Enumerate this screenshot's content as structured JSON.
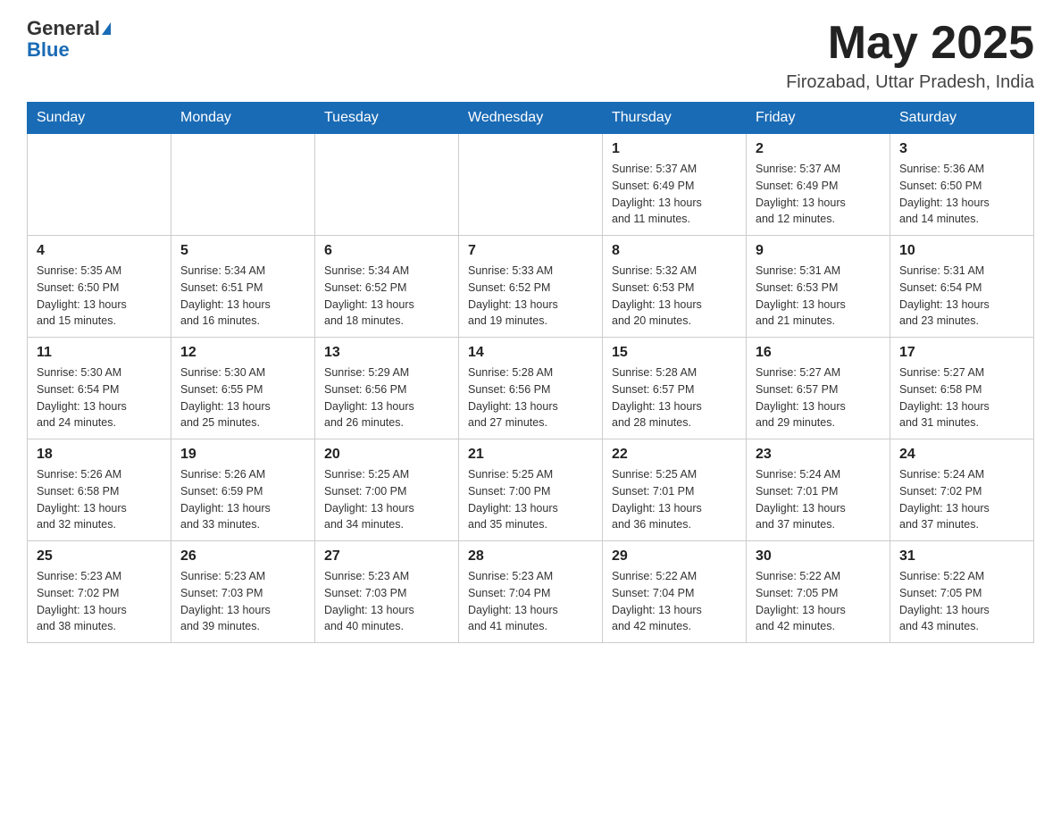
{
  "header": {
    "logo_general": "General",
    "logo_blue": "Blue",
    "month_title": "May 2025",
    "location": "Firozabad, Uttar Pradesh, India"
  },
  "days_of_week": [
    "Sunday",
    "Monday",
    "Tuesday",
    "Wednesday",
    "Thursday",
    "Friday",
    "Saturday"
  ],
  "weeks": [
    [
      {
        "day": "",
        "info": ""
      },
      {
        "day": "",
        "info": ""
      },
      {
        "day": "",
        "info": ""
      },
      {
        "day": "",
        "info": ""
      },
      {
        "day": "1",
        "info": "Sunrise: 5:37 AM\nSunset: 6:49 PM\nDaylight: 13 hours\nand 11 minutes."
      },
      {
        "day": "2",
        "info": "Sunrise: 5:37 AM\nSunset: 6:49 PM\nDaylight: 13 hours\nand 12 minutes."
      },
      {
        "day": "3",
        "info": "Sunrise: 5:36 AM\nSunset: 6:50 PM\nDaylight: 13 hours\nand 14 minutes."
      }
    ],
    [
      {
        "day": "4",
        "info": "Sunrise: 5:35 AM\nSunset: 6:50 PM\nDaylight: 13 hours\nand 15 minutes."
      },
      {
        "day": "5",
        "info": "Sunrise: 5:34 AM\nSunset: 6:51 PM\nDaylight: 13 hours\nand 16 minutes."
      },
      {
        "day": "6",
        "info": "Sunrise: 5:34 AM\nSunset: 6:52 PM\nDaylight: 13 hours\nand 18 minutes."
      },
      {
        "day": "7",
        "info": "Sunrise: 5:33 AM\nSunset: 6:52 PM\nDaylight: 13 hours\nand 19 minutes."
      },
      {
        "day": "8",
        "info": "Sunrise: 5:32 AM\nSunset: 6:53 PM\nDaylight: 13 hours\nand 20 minutes."
      },
      {
        "day": "9",
        "info": "Sunrise: 5:31 AM\nSunset: 6:53 PM\nDaylight: 13 hours\nand 21 minutes."
      },
      {
        "day": "10",
        "info": "Sunrise: 5:31 AM\nSunset: 6:54 PM\nDaylight: 13 hours\nand 23 minutes."
      }
    ],
    [
      {
        "day": "11",
        "info": "Sunrise: 5:30 AM\nSunset: 6:54 PM\nDaylight: 13 hours\nand 24 minutes."
      },
      {
        "day": "12",
        "info": "Sunrise: 5:30 AM\nSunset: 6:55 PM\nDaylight: 13 hours\nand 25 minutes."
      },
      {
        "day": "13",
        "info": "Sunrise: 5:29 AM\nSunset: 6:56 PM\nDaylight: 13 hours\nand 26 minutes."
      },
      {
        "day": "14",
        "info": "Sunrise: 5:28 AM\nSunset: 6:56 PM\nDaylight: 13 hours\nand 27 minutes."
      },
      {
        "day": "15",
        "info": "Sunrise: 5:28 AM\nSunset: 6:57 PM\nDaylight: 13 hours\nand 28 minutes."
      },
      {
        "day": "16",
        "info": "Sunrise: 5:27 AM\nSunset: 6:57 PM\nDaylight: 13 hours\nand 29 minutes."
      },
      {
        "day": "17",
        "info": "Sunrise: 5:27 AM\nSunset: 6:58 PM\nDaylight: 13 hours\nand 31 minutes."
      }
    ],
    [
      {
        "day": "18",
        "info": "Sunrise: 5:26 AM\nSunset: 6:58 PM\nDaylight: 13 hours\nand 32 minutes."
      },
      {
        "day": "19",
        "info": "Sunrise: 5:26 AM\nSunset: 6:59 PM\nDaylight: 13 hours\nand 33 minutes."
      },
      {
        "day": "20",
        "info": "Sunrise: 5:25 AM\nSunset: 7:00 PM\nDaylight: 13 hours\nand 34 minutes."
      },
      {
        "day": "21",
        "info": "Sunrise: 5:25 AM\nSunset: 7:00 PM\nDaylight: 13 hours\nand 35 minutes."
      },
      {
        "day": "22",
        "info": "Sunrise: 5:25 AM\nSunset: 7:01 PM\nDaylight: 13 hours\nand 36 minutes."
      },
      {
        "day": "23",
        "info": "Sunrise: 5:24 AM\nSunset: 7:01 PM\nDaylight: 13 hours\nand 37 minutes."
      },
      {
        "day": "24",
        "info": "Sunrise: 5:24 AM\nSunset: 7:02 PM\nDaylight: 13 hours\nand 37 minutes."
      }
    ],
    [
      {
        "day": "25",
        "info": "Sunrise: 5:23 AM\nSunset: 7:02 PM\nDaylight: 13 hours\nand 38 minutes."
      },
      {
        "day": "26",
        "info": "Sunrise: 5:23 AM\nSunset: 7:03 PM\nDaylight: 13 hours\nand 39 minutes."
      },
      {
        "day": "27",
        "info": "Sunrise: 5:23 AM\nSunset: 7:03 PM\nDaylight: 13 hours\nand 40 minutes."
      },
      {
        "day": "28",
        "info": "Sunrise: 5:23 AM\nSunset: 7:04 PM\nDaylight: 13 hours\nand 41 minutes."
      },
      {
        "day": "29",
        "info": "Sunrise: 5:22 AM\nSunset: 7:04 PM\nDaylight: 13 hours\nand 42 minutes."
      },
      {
        "day": "30",
        "info": "Sunrise: 5:22 AM\nSunset: 7:05 PM\nDaylight: 13 hours\nand 42 minutes."
      },
      {
        "day": "31",
        "info": "Sunrise: 5:22 AM\nSunset: 7:05 PM\nDaylight: 13 hours\nand 43 minutes."
      }
    ]
  ]
}
